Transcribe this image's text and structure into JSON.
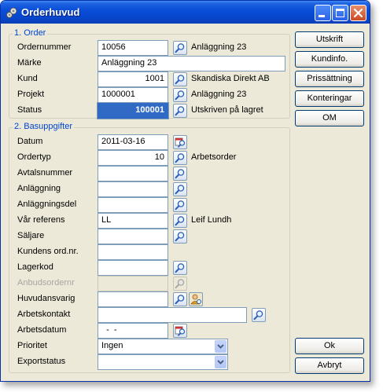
{
  "window": {
    "title": "Orderhuvud"
  },
  "order_group": {
    "legend": "1. Order",
    "ordernummer": {
      "label": "Ordernummer",
      "value": "10056",
      "info": "Anläggning 23"
    },
    "marke": {
      "label": "Märke",
      "value": "Anläggning 23"
    },
    "kund": {
      "label": "Kund",
      "value": "1001",
      "info": "Skandiska Direkt AB"
    },
    "projekt": {
      "label": "Projekt",
      "value": "1000001",
      "info": "Anläggning 23"
    },
    "status": {
      "label": "Status",
      "value": "100001",
      "info": "Utskriven på lagret"
    }
  },
  "base_group": {
    "legend": "2. Basuppgifter",
    "datum": {
      "label": "Datum",
      "value": "2011-03-16"
    },
    "ordertyp": {
      "label": "Ordertyp",
      "value": "10",
      "info": "Arbetsorder"
    },
    "avtalsnummer": {
      "label": "Avtalsnummer",
      "value": ""
    },
    "anlaggning": {
      "label": "Anläggning",
      "value": ""
    },
    "anlaggningsdel": {
      "label": "Anläggningsdel",
      "value": ""
    },
    "var_referens": {
      "label": "Vår referens",
      "value": "LL",
      "info": "Leif Lundh"
    },
    "saljare": {
      "label": "Säljare",
      "value": ""
    },
    "kundens_ordnr": {
      "label": "Kundens ord.nr.",
      "value": ""
    },
    "lagerkod": {
      "label": "Lagerkod",
      "value": ""
    },
    "anbudsordernr": {
      "label": "Anbudsordernr",
      "value": ""
    },
    "huvudansvarig": {
      "label": "Huvudansvarig",
      "value": ""
    },
    "arbetskontakt": {
      "label": "Arbetskontakt",
      "value": ""
    },
    "arbetsdatum": {
      "label": "Arbetsdatum",
      "value": "  -  -"
    },
    "prioritet": {
      "label": "Prioritet",
      "value": "Ingen"
    },
    "exportstatus": {
      "label": "Exportstatus",
      "value": ""
    }
  },
  "buttons": {
    "utskrift": "Utskrift",
    "kundinfo": "Kundinfo.",
    "prissattning": "Prissättning",
    "konteringar": "Konteringar",
    "om": "OM",
    "ok": "Ok",
    "avbryt": "Avbryt"
  },
  "colors": {
    "titlebar": "#0a4ed8",
    "legend": "#0046d5",
    "selection": "#316ac5",
    "window_bg": "#ece9d8"
  },
  "icons": [
    "app-icon",
    "minimize-icon",
    "maximize-icon",
    "close-icon",
    "search-icon",
    "calendar-search-icon",
    "person-search-icon"
  ]
}
